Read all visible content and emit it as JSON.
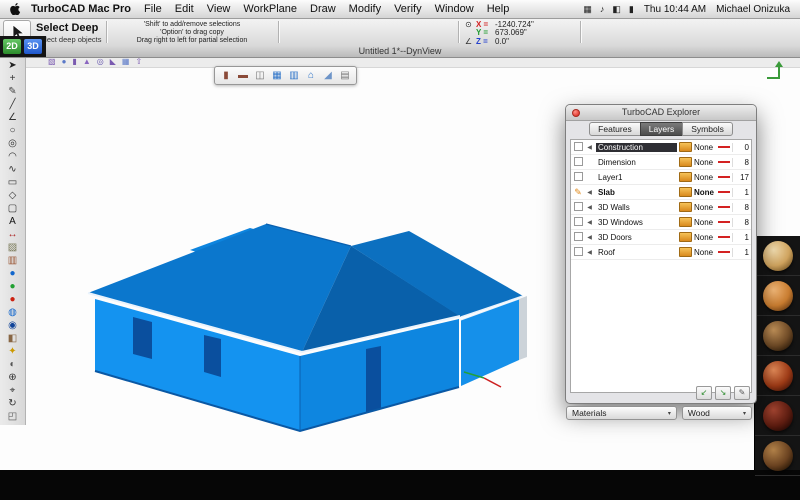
{
  "menubar": {
    "app_name": "TurboCAD Mac Pro",
    "menus": [
      "File",
      "Edit",
      "View",
      "WorkPlane",
      "Draw",
      "Modify",
      "Verify",
      "Window",
      "Help"
    ],
    "status_icons": [
      {
        "name": "displays-icon",
        "glyph": "▦"
      },
      {
        "name": "volume-icon",
        "glyph": "♪"
      },
      {
        "name": "airport-icon",
        "glyph": "◧"
      },
      {
        "name": "battery-icon",
        "glyph": "▮"
      }
    ],
    "time": "Thu 10:44 AM",
    "user": "Michael Onizuka"
  },
  "toolbar": {
    "tool_name": "Select Deep",
    "tool_description": "Select deep objects",
    "hint_line1": "'Shift' to add/remove selections",
    "hint_line2": "'Option' to drag copy",
    "hint_line3": "Drag right to left for partial selection",
    "coordinates": {
      "x_label": "X =",
      "x_value": "-1240.724\"",
      "y_label": "Y =",
      "y_value": "673.069\"",
      "z_label": "Z =",
      "z_value": "0.0\""
    }
  },
  "mode_toggle": {
    "label_2d": "2D",
    "label_3d": "3D"
  },
  "document": {
    "title": "Untitled 1*--DynView"
  },
  "solids_toolbar": {
    "icons": [
      {
        "name": "3d-box-icon",
        "glyph": "▧",
        "color": "#7a5ab0"
      },
      {
        "name": "3d-sphere-icon",
        "glyph": "●",
        "color": "#5b79c8"
      },
      {
        "name": "3d-cylinder-icon",
        "glyph": "▮",
        "color": "#7a5ab0"
      },
      {
        "name": "3d-cone-icon",
        "glyph": "▲",
        "color": "#8a66c0"
      },
      {
        "name": "3d-torus-icon",
        "glyph": "◎",
        "color": "#6a5ab0"
      },
      {
        "name": "3d-wedge-icon",
        "glyph": "◣",
        "color": "#7a5ab0"
      },
      {
        "name": "3d-mesh-icon",
        "glyph": "▦",
        "color": "#5b79c8"
      },
      {
        "name": "3d-extrude-icon",
        "glyph": "⇧",
        "color": "#7a5ab0"
      }
    ]
  },
  "shape_toolbar": {
    "icons": [
      {
        "name": "wall-tool-icon",
        "glyph": "▮",
        "color": "#8a4a38"
      },
      {
        "name": "wall-chain-tool-icon",
        "glyph": "▬",
        "color": "#8a4a38"
      },
      {
        "name": "door-tool-icon",
        "glyph": "◫",
        "color": "#777777"
      },
      {
        "name": "window-tool-icon",
        "glyph": "▦",
        "color": "#2b72c8"
      },
      {
        "name": "window-grid-tool-icon",
        "glyph": "▥",
        "color": "#2b72c8"
      },
      {
        "name": "roof-tool-icon",
        "glyph": "⌂",
        "color": "#2b72c8"
      },
      {
        "name": "slab-tool-icon",
        "glyph": "◢",
        "color": "#6d94c8"
      },
      {
        "name": "stair-tool-icon",
        "glyph": "▤",
        "color": "#777777"
      }
    ]
  },
  "tool_palette": {
    "icons": [
      {
        "name": "select-arrow",
        "glyph": "➤",
        "color": "#222222"
      },
      {
        "name": "crosshair",
        "glyph": "+",
        "color": "#333333"
      },
      {
        "name": "pen",
        "glyph": "✎",
        "color": "#444444"
      },
      {
        "name": "line",
        "glyph": "╱",
        "color": "#333333"
      },
      {
        "name": "polyline",
        "glyph": "∠",
        "color": "#333333"
      },
      {
        "name": "circle",
        "glyph": "○",
        "color": "#333333"
      },
      {
        "name": "concentric-circle",
        "glyph": "◎",
        "color": "#333333"
      },
      {
        "name": "arc",
        "glyph": "◠",
        "color": "#333333"
      },
      {
        "name": "spline",
        "glyph": "∿",
        "color": "#333333"
      },
      {
        "name": "rectangle",
        "glyph": "▭",
        "color": "#333333"
      },
      {
        "name": "polygon",
        "glyph": "◇",
        "color": "#333333"
      },
      {
        "name": "rounded-rectangle",
        "glyph": "▢",
        "color": "#333333"
      },
      {
        "name": "text",
        "glyph": "A",
        "color": "#111111"
      },
      {
        "name": "dimension",
        "glyph": "↔",
        "color": "#aa2222"
      },
      {
        "name": "hatch",
        "glyph": "▨",
        "color": "#777755"
      },
      {
        "name": "wall",
        "glyph": "▥",
        "color": "#995533"
      },
      {
        "name": "sphere-blue",
        "glyph": "●",
        "color": "#1166cc"
      },
      {
        "name": "sphere-green",
        "glyph": "●",
        "color": "#22a033"
      },
      {
        "name": "sphere-red",
        "glyph": "●",
        "color": "#cc2211"
      },
      {
        "name": "torus",
        "glyph": "◍",
        "color": "#1166cc"
      },
      {
        "name": "globe",
        "glyph": "◉",
        "color": "#114499"
      },
      {
        "name": "material-brush",
        "glyph": "◧",
        "color": "#886644"
      },
      {
        "name": "light",
        "glyph": "✦",
        "color": "#cc9900"
      },
      {
        "name": "camera",
        "glyph": "◐",
        "color": "#555555"
      },
      {
        "name": "zoom",
        "glyph": "⊕",
        "color": "#333333"
      },
      {
        "name": "pan",
        "glyph": "⌖",
        "color": "#333333"
      },
      {
        "name": "orbit",
        "glyph": "↻",
        "color": "#333333"
      },
      {
        "name": "view-cube",
        "glyph": "◰",
        "color": "#555555"
      }
    ]
  },
  "explorer": {
    "title": "TurboCAD Explorer",
    "tabs": [
      "Features",
      "Layers",
      "Symbols"
    ],
    "active_tab": "Layers",
    "layers": [
      {
        "name": "Construction",
        "pen": "None",
        "count": "0",
        "speaker": true,
        "highlight": true,
        "active": false
      },
      {
        "name": "Dimension",
        "pen": "None",
        "count": "8",
        "speaker": false,
        "highlight": false,
        "active": false
      },
      {
        "name": "Layer1",
        "pen": "None",
        "count": "17",
        "speaker": false,
        "highlight": false,
        "active": false
      },
      {
        "name": "Slab",
        "pen": "None",
        "count": "1",
        "speaker": true,
        "highlight": false,
        "active": true
      },
      {
        "name": "3D Walls",
        "pen": "None",
        "count": "8",
        "speaker": true,
        "highlight": false,
        "active": false
      },
      {
        "name": "3D Windows",
        "pen": "None",
        "count": "8",
        "speaker": true,
        "highlight": false,
        "active": false
      },
      {
        "name": "3D Doors",
        "pen": "None",
        "count": "1",
        "speaker": true,
        "highlight": false,
        "active": false
      },
      {
        "name": "Roof",
        "pen": "None",
        "count": "1",
        "speaker": true,
        "highlight": false,
        "active": false
      }
    ],
    "buttons": [
      {
        "name": "send-to-layer-button",
        "glyph": "↙",
        "color": "#2a8a2a"
      },
      {
        "name": "copy-to-layer-button",
        "glyph": "↘",
        "color": "#2a8a2a"
      },
      {
        "name": "edit-layers-button",
        "glyph": "✎",
        "color": "#555555"
      }
    ]
  },
  "materials_bar": {
    "category": "Materials",
    "type": "Wood"
  },
  "material_swatches": [
    {
      "name": "light-oak",
      "hi": "#f2ddb0",
      "mid": "#cfa35e",
      "dark": "#6f4f20"
    },
    {
      "name": "honey-maple",
      "hi": "#f2b878",
      "mid": "#c87c30",
      "dark": "#5f3510"
    },
    {
      "name": "walnut",
      "hi": "#c09058",
      "mid": "#6e4a26",
      "dark": "#241507"
    },
    {
      "name": "mahogany",
      "hi": "#e28a58",
      "mid": "#9c3a16",
      "dark": "#3f1206"
    },
    {
      "name": "dark-cherry",
      "hi": "#a24430",
      "mid": "#5c1c10",
      "dark": "#1c0602"
    },
    {
      "name": "teak",
      "hi": "#b08048",
      "mid": "#6a4220",
      "dark": "#201204"
    }
  ],
  "model": {
    "roof_rear": "#0d84de",
    "roof_left": "#0b77cd",
    "roof_right": "#0960aa",
    "roof_wing": "#0c70c0",
    "wall_left": "#1493f0",
    "wall_right": "#0e86e0",
    "wall_wing": "#1590ea",
    "edge": "#ccd3d9",
    "opening": "#0a4f9e",
    "trim": "#eaf3fc",
    "ridge": "#0a60b0",
    "base": "#0a58a4",
    "axis_x": "#cc2020",
    "axis_y": "#23a03a",
    "widget": "#3a9a3a"
  }
}
